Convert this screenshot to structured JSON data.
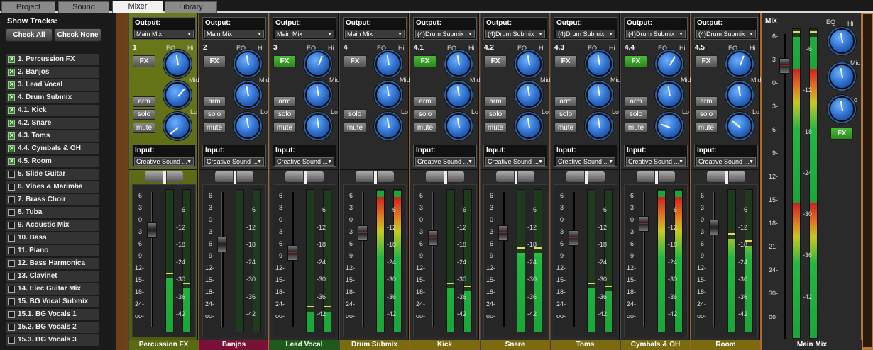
{
  "tabs": [
    "Project",
    "Sound",
    "Mixer",
    "Library"
  ],
  "active_tab": "Mixer",
  "sidebar": {
    "show_label": "Show Tracks:",
    "check_all": "Check All",
    "check_none": "Check None",
    "tracks": [
      {
        "label": "1. Percussion FX",
        "checked": true
      },
      {
        "label": "2. Banjos",
        "checked": true
      },
      {
        "label": "3. Lead Vocal",
        "checked": true
      },
      {
        "label": "4. Drum Submix",
        "checked": true
      },
      {
        "label": "4.1. Kick",
        "checked": true
      },
      {
        "label": "4.2. Snare",
        "checked": true
      },
      {
        "label": "4.3. Toms",
        "checked": true
      },
      {
        "label": "4.4. Cymbals & OH",
        "checked": true
      },
      {
        "label": "4.5. Room",
        "checked": true
      },
      {
        "label": "5. Slide Guitar",
        "checked": false
      },
      {
        "label": "6. Vibes & Marimba",
        "checked": false
      },
      {
        "label": "7. Brass Choir",
        "checked": false
      },
      {
        "label": "8. Tuba",
        "checked": false
      },
      {
        "label": "9. Acoustic Mix",
        "checked": false
      },
      {
        "label": "10. Bass",
        "checked": false
      },
      {
        "label": "11. Piano",
        "checked": false
      },
      {
        "label": "12. Bass Harmonica",
        "checked": false
      },
      {
        "label": "13. Clavinet",
        "checked": false
      },
      {
        "label": "14. Elec Guitar Mix",
        "checked": false
      },
      {
        "label": "15. BG Vocal Submix",
        "checked": false
      },
      {
        "label": "15.1. BG Vocals 1",
        "checked": false
      },
      {
        "label": "15.2. BG Vocals 2",
        "checked": false
      },
      {
        "label": "15.3. BG Vocals 3",
        "checked": false
      }
    ]
  },
  "labels": {
    "output": "Output:",
    "input": "Input:",
    "eq": "EQ",
    "hi": "Hi",
    "mid": "Mid",
    "lo": "Lo",
    "fx": "FX",
    "arm": "arm",
    "solo": "solo",
    "mute": "mute",
    "mix": "Mix"
  },
  "fader_scale": [
    "6-",
    "3-",
    "0-",
    "3-",
    "6-",
    "9-",
    "12-",
    "15-",
    "18-",
    "24-",
    "oo-"
  ],
  "meter_scale": [
    "-6",
    "-12",
    "-18",
    "-24",
    "-30",
    "-36",
    "-42"
  ],
  "main_fader_scale": [
    "6-",
    "3-",
    "0-",
    "3-",
    "6-",
    "9-",
    "12-",
    "15-",
    "18-",
    "21-",
    "24-",
    "30-",
    "oo-"
  ],
  "strips": [
    {
      "num": "1",
      "output": "Main Mix",
      "input": "Creative Sound ...",
      "fx_on": false,
      "has_arm": true,
      "has_mute": true,
      "name": "Percussion FX",
      "name_color": "#5a6a12",
      "fader": 0.25,
      "meter": [
        0.37,
        0.3
      ],
      "knobs": [
        -10,
        40,
        -130
      ]
    },
    {
      "num": "2",
      "output": "Main Mix",
      "input": "Creative Sound ...",
      "fx_on": false,
      "has_arm": true,
      "has_mute": true,
      "name": "Banjos",
      "name_color": "#7a1238",
      "fader": 0.36,
      "meter": [
        0.0,
        0.0
      ],
      "knobs": [
        -10,
        -10,
        -10
      ]
    },
    {
      "num": "3",
      "output": "Main Mix",
      "input": "Creative Sound ...",
      "fx_on": true,
      "has_arm": true,
      "has_mute": true,
      "name": "Lead Vocal",
      "name_color": "#1f5a1a",
      "fader": 0.43,
      "meter": [
        0.14,
        0.14
      ],
      "knobs": [
        20,
        -10,
        -10
      ]
    },
    {
      "num": "4",
      "output": "Main Mix",
      "input": "",
      "fx_on": false,
      "has_arm": false,
      "has_mute": true,
      "name": "Drum Submix",
      "name_color": "#7a6a10",
      "fader": 0.27,
      "meter": [
        0.98,
        0.98
      ],
      "knobs": [
        -10,
        -10,
        -10
      ]
    },
    {
      "num": "4.1",
      "output": "(4)Drum Submix",
      "input": "Creative Sound ...",
      "fx_on": true,
      "has_arm": true,
      "has_mute": true,
      "name": "Kick",
      "name_color": "#7a6a10",
      "fader": 0.31,
      "meter": [
        0.3,
        0.28
      ],
      "knobs": [
        -10,
        -10,
        -10
      ]
    },
    {
      "num": "4.2",
      "output": "(4)Drum Submix",
      "input": "Creative Sound ...",
      "fx_on": false,
      "has_arm": true,
      "has_mute": true,
      "name": "Snare",
      "name_color": "#7a6a10",
      "fader": 0.27,
      "meter": [
        0.55,
        0.55
      ],
      "knobs": [
        -10,
        -10,
        -10
      ]
    },
    {
      "num": "4.3",
      "output": "(4)Drum Submix",
      "input": "Creative Sound ...",
      "fx_on": false,
      "has_arm": true,
      "has_mute": true,
      "name": "Toms",
      "name_color": "#7a6a10",
      "fader": 0.31,
      "meter": [
        0.3,
        0.28
      ],
      "knobs": [
        -10,
        -10,
        -10
      ]
    },
    {
      "num": "4.4",
      "output": "(4)Drum Submix",
      "input": "Creative Sound ...",
      "fx_on": true,
      "has_arm": true,
      "has_mute": true,
      "name": "Cymbals & OH",
      "name_color": "#7a6a10",
      "fader": 0.2,
      "meter": [
        0.98,
        0.98
      ],
      "knobs": [
        30,
        -10,
        -70
      ]
    },
    {
      "num": "4.5",
      "output": "(4)Drum Submix",
      "input": "Creative Sound ...",
      "fx_on": false,
      "has_arm": true,
      "has_mute": true,
      "name": "Room",
      "name_color": "#7a6a10",
      "fader": 0.23,
      "meter": [
        0.65,
        0.6
      ],
      "knobs": [
        20,
        -10,
        -50
      ]
    }
  ],
  "main_mix": {
    "name": "Main Mix",
    "name_color": "#2a2a2a",
    "fader": 0.08,
    "meter": [
      0.97,
      0.97
    ],
    "knobs": [
      -10,
      -10,
      -10
    ],
    "fx_on": true
  }
}
